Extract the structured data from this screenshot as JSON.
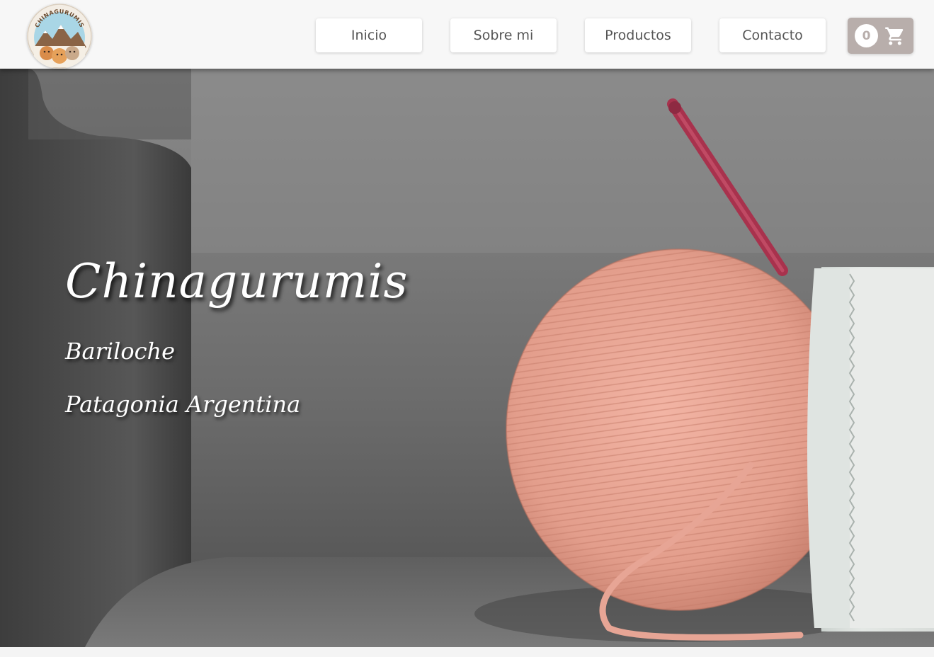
{
  "header": {
    "logo_text": "CHINAGURUMIS",
    "nav": {
      "inicio": "Inicio",
      "sobre_mi": "Sobre mi",
      "productos": "Productos",
      "contacto": "Contacto"
    },
    "cart": {
      "count": "0",
      "icon": "shopping-cart-icon"
    }
  },
  "hero": {
    "title": "Chinagurumis",
    "line1": "Bariloche",
    "line2": "Patagonia Argentina"
  },
  "colors": {
    "header_bg": "#f7f7f7",
    "cart_bg": "#b8aeab",
    "yarn": "#e8a898",
    "hook": "#b03a55",
    "sofa": "#6f6f6f"
  }
}
